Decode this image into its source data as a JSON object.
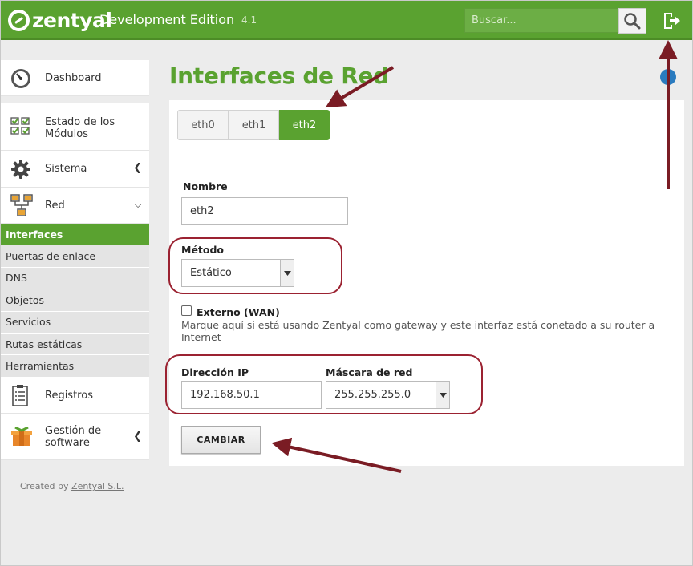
{
  "header": {
    "brand": "zentyal",
    "edition": "Development Edition",
    "version": "4.1",
    "search_placeholder": "Buscar...",
    "accent_color": "#5aa230",
    "icons": {
      "search": "search-icon",
      "logout": "logout-icon"
    }
  },
  "sidebar": {
    "items": [
      {
        "label": "Dashboard",
        "icon": "dashboard-icon"
      },
      {
        "label": "Estado de los Módulos",
        "line1": "Estado de los",
        "line2": "Módulos",
        "icon": "module-status-icon"
      },
      {
        "label": "Sistema",
        "icon": "gear-icon",
        "chevron": "chevron-left-icon"
      },
      {
        "label": "Red",
        "icon": "network-icon",
        "chevron": "chevron-down-icon"
      },
      {
        "label": "Registros",
        "icon": "logs-icon"
      },
      {
        "label": "Gestión de software",
        "line1": "Gestión de",
        "line2": "software",
        "icon": "software-package-icon",
        "chevron": "chevron-left-icon"
      }
    ],
    "submenu": [
      {
        "label": "Interfaces",
        "active": true
      },
      {
        "label": "Puertas de enlace"
      },
      {
        "label": "DNS"
      },
      {
        "label": "Objetos"
      },
      {
        "label": "Servicios"
      },
      {
        "label": "Rutas estáticas"
      },
      {
        "label": "Herramientas"
      }
    ],
    "footer": {
      "prefix": "Created by",
      "link": "Zentyal S.L."
    }
  },
  "main": {
    "title": "Interfaces de Red",
    "tabs": [
      {
        "label": "eth0"
      },
      {
        "label": "eth1"
      },
      {
        "label": "eth2",
        "active": true
      }
    ],
    "form": {
      "nombre_label": "Nombre",
      "nombre_value": "eth2",
      "metodo_label": "Método",
      "metodo_value": "Estático",
      "externo_label": "Externo (WAN)",
      "externo_checked": false,
      "externo_help": "Marque aquí si está usando Zentyal como gateway y este interfaz está conetado a su router a Internet",
      "ip_label": "Dirección IP",
      "ip_value": "192.168.50.1",
      "mask_label": "Máscara de red",
      "mask_value": "255.255.255.0",
      "submit_label": "CAMBIAR"
    }
  },
  "annotations": {
    "color": "#7a1c24"
  }
}
